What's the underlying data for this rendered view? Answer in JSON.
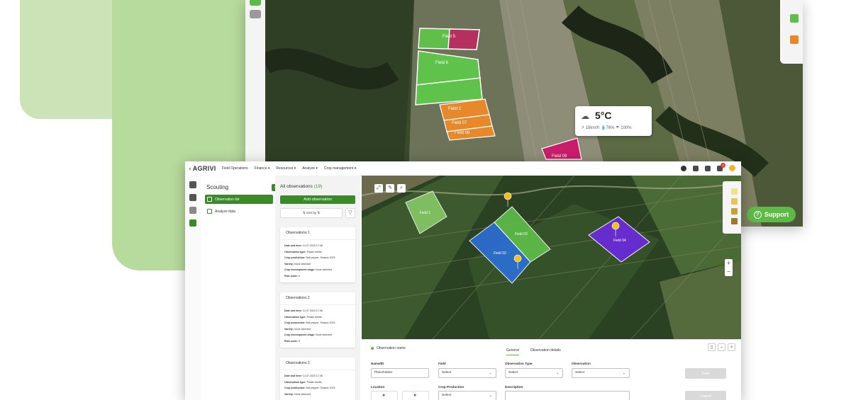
{
  "background_screen": {
    "weather": {
      "temperature": "5°C",
      "stats": "↗ 18km/h  💧76%  ☂ 100%"
    },
    "fields": [
      "Field 5",
      "Field 6",
      "Field 2",
      "Field 07",
      "Field 08",
      "Field 09"
    ],
    "support_label": "Support"
  },
  "app": {
    "logo_prefix": "AGRIVI",
    "nav": [
      "Field Operations",
      "Finance ▾",
      "Resources ▾",
      "Analyze ▾",
      "Crop management ▾"
    ],
    "notification_count": "3"
  },
  "scouting": {
    "title": "Scouting",
    "items": [
      "Observation list",
      "Analyze data"
    ]
  },
  "observations": {
    "title": "All observations",
    "count": "(19)",
    "add_label": "Add observation",
    "sort_label": "⇅  Sort by ⇅",
    "cards": [
      {
        "title": "Observations 1",
        "date": "14.07.2023 17:46",
        "type": "Potato beetle",
        "crop": "Bell pepper, Season 2023",
        "variety": "None selected",
        "stage": "None selected",
        "risk": "5"
      },
      {
        "title": "Observations 2",
        "date": "14.07.2023 17:46",
        "type": "Potato beetle",
        "crop": "Bell pepper, Season 2023",
        "variety": "None selected",
        "stage": "None selected",
        "risk": "5"
      },
      {
        "title": "Observations 3",
        "date": "14.07.2023 17:46",
        "type": "Potato beetle",
        "crop": "Bell pepper, Season 2023",
        "variety": "None selected",
        "stage": "",
        "risk": ""
      }
    ],
    "labels": {
      "date": "Date and time:",
      "type": "Observation type:",
      "crop": "Crop production:",
      "variety": "Variety:",
      "stage": "Crop development stage:",
      "risk": "Risk scale:"
    }
  },
  "map": {
    "fields": [
      "Field 1",
      "Field 02",
      "Field 03",
      "Field 04"
    ]
  },
  "detail": {
    "title": "Observation name",
    "tabs": [
      "General",
      "Observation details"
    ],
    "name_label": "Name/ID",
    "name_value": "Placeholder",
    "field_label": "Field",
    "field_value": "Select",
    "type_label": "Observation Type",
    "type_value": "Select",
    "observation_label": "Observation",
    "observation_value": "Select",
    "location_label": "Location",
    "crop_label": "Crop Production",
    "crop_value": "Select",
    "description_label": "Description",
    "save_label": "Save",
    "cancel_label": "Cancel"
  },
  "colors": {
    "brand_green": "#3a8a2a",
    "accent_green": "#5fb946",
    "field_blue": "#2a6fd6",
    "field_purple": "#6a2bd6",
    "field_orange": "#e7892a",
    "field_magenta": "#c81d6b"
  }
}
